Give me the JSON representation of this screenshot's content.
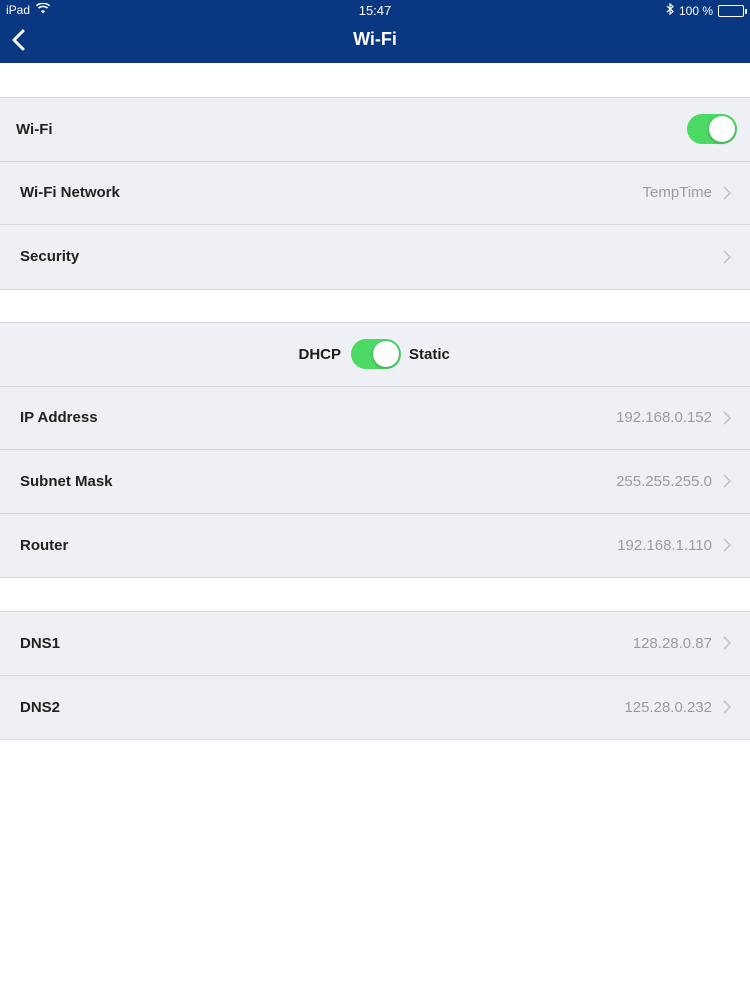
{
  "status_bar": {
    "device": "iPad",
    "time": "15:47",
    "battery_text": "100 %"
  },
  "nav": {
    "title": "Wi-Fi",
    "back_icon": "chevron-left-icon"
  },
  "wifi_group": {
    "wifi_label": "Wi-Fi",
    "wifi_enabled": true,
    "network_label": "Wi-Fi Network",
    "network_value": "TempTime",
    "security_label": "Security",
    "security_value": ""
  },
  "ip_group": {
    "dhcp_label": "DHCP",
    "static_label": "Static",
    "static_enabled": true,
    "ip_label": "IP Address",
    "ip_value": "192.168.0.152",
    "subnet_label": "Subnet Mask",
    "subnet_value": "255.255.255.0",
    "router_label": "Router",
    "router_value": "192.168.1.110"
  },
  "dns_group": {
    "dns1_label": "DNS1",
    "dns1_value": "128.28.0.87",
    "dns2_label": "DNS2",
    "dns2_value": "125.28.0.232"
  },
  "colors": {
    "nav_bar": "#0a3782",
    "toggle_on": "#4cd964",
    "group_bg": "#eff0f5",
    "value_text": "#9b9ba0"
  }
}
